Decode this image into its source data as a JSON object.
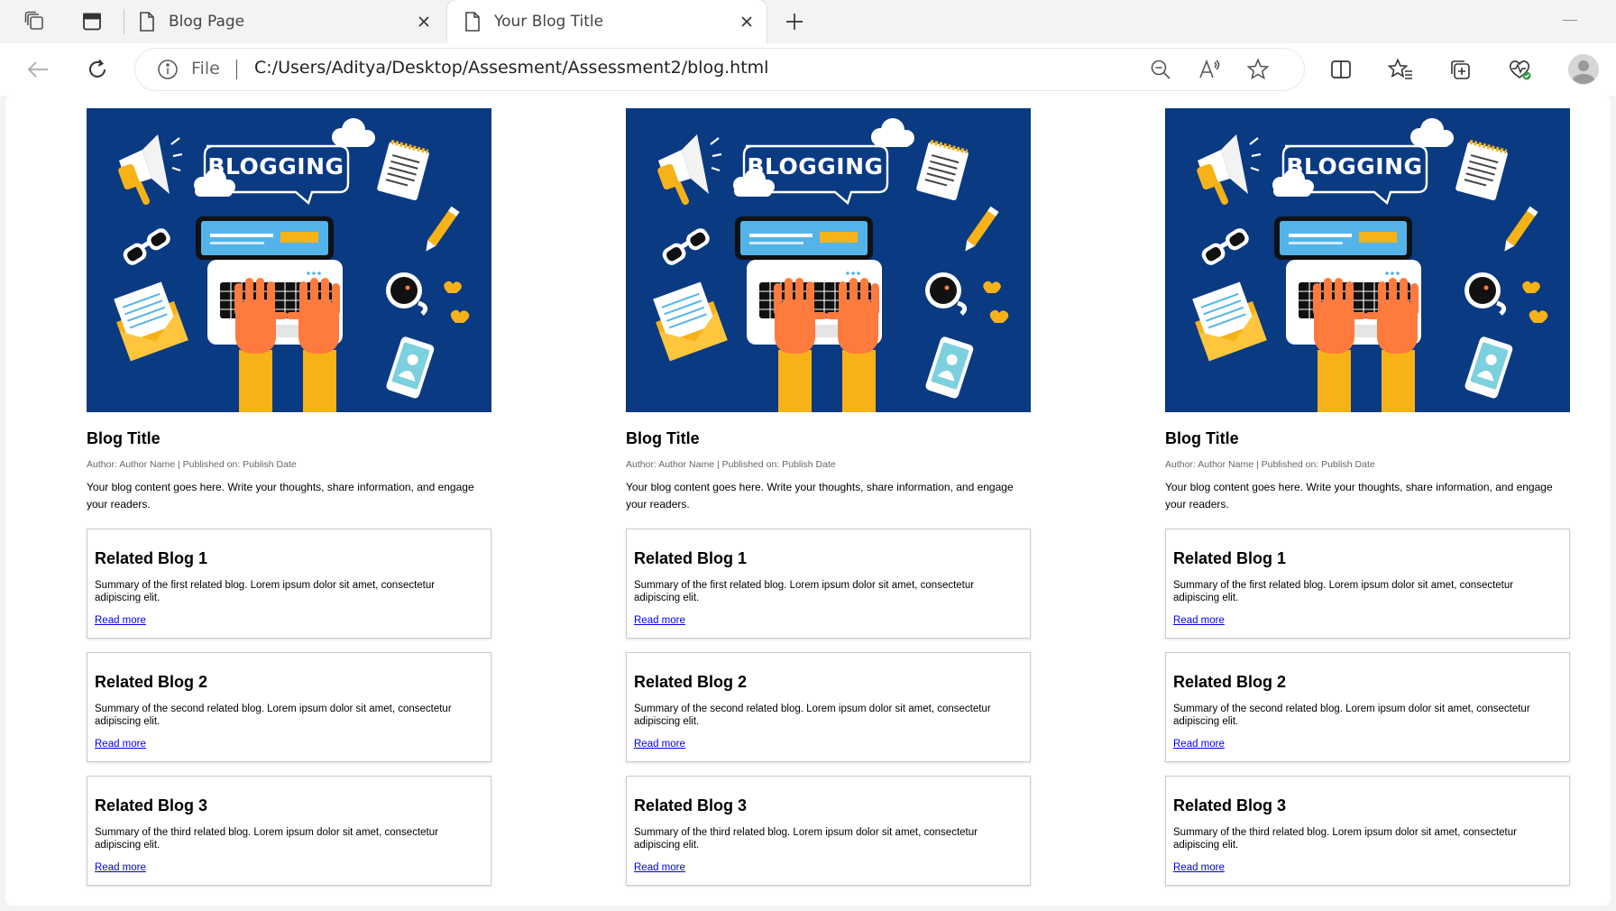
{
  "browser": {
    "tabs": [
      {
        "title": "Blog Page",
        "active": false
      },
      {
        "title": "Your Blog Title",
        "active": true
      }
    ],
    "address": {
      "scheme_label": "File",
      "url": "C:/Users/Aditya/Desktop/Assesment/Assessment2/blog.html"
    },
    "icons": {
      "workspaces": "workspaces-icon",
      "tab_actions": "vertical-tabs-icon",
      "page": "page-icon",
      "close": "close-icon",
      "new_tab": "plus-icon",
      "back": "back-arrow-icon",
      "refresh": "refresh-icon",
      "info": "info-icon",
      "zoom": "zoom-out-icon",
      "read_aloud": "read-aloud-icon",
      "favorite": "star-icon",
      "split_screen": "split-screen-icon",
      "favorites": "favorites-icon",
      "collections": "collections-icon",
      "health": "browser-essentials-icon",
      "profile": "profile-icon"
    }
  },
  "page": {
    "hero_text": "BLOGGING",
    "columns": [
      {
        "title": "Blog Title",
        "meta": "Author: Author Name | Published on: Publish Date",
        "content": "Your blog content goes here. Write your thoughts, share information, and engage your readers.",
        "related": [
          {
            "title": "Related Blog 1",
            "summary": "Summary of the first related blog. Lorem ipsum dolor sit amet, consectetur adipiscing elit.",
            "link": "Read more"
          },
          {
            "title": "Related Blog 2",
            "summary": "Summary of the second related blog. Lorem ipsum dolor sit amet, consectetur adipiscing elit.",
            "link": "Read more"
          },
          {
            "title": "Related Blog 3",
            "summary": "Summary of the third related blog. Lorem ipsum dolor sit amet, consectetur adipiscing elit.",
            "link": "Read more"
          }
        ]
      },
      {
        "title": "Blog Title",
        "meta": "Author: Author Name | Published on: Publish Date",
        "content": "Your blog content goes here. Write your thoughts, share information, and engage your readers.",
        "related": [
          {
            "title": "Related Blog 1",
            "summary": "Summary of the first related blog. Lorem ipsum dolor sit amet, consectetur adipiscing elit.",
            "link": "Read more"
          },
          {
            "title": "Related Blog 2",
            "summary": "Summary of the second related blog. Lorem ipsum dolor sit amet, consectetur adipiscing elit.",
            "link": "Read more"
          },
          {
            "title": "Related Blog 3",
            "summary": "Summary of the third related blog. Lorem ipsum dolor sit amet, consectetur adipiscing elit.",
            "link": "Read more"
          }
        ]
      },
      {
        "title": "Blog Title",
        "meta": "Author: Author Name | Published on: Publish Date",
        "content": "Your blog content goes here. Write your thoughts, share information, and engage your readers.",
        "related": [
          {
            "title": "Related Blog 1",
            "summary": "Summary of the first related blog. Lorem ipsum dolor sit amet, consectetur adipiscing elit.",
            "link": "Read more"
          },
          {
            "title": "Related Blog 2",
            "summary": "Summary of the second related blog. Lorem ipsum dolor sit amet, consectetur adipiscing elit.",
            "link": "Read more"
          },
          {
            "title": "Related Blog 3",
            "summary": "Summary of the third related blog. Lorem ipsum dolor sit amet, consectetur adipiscing elit.",
            "link": "Read more"
          }
        ]
      }
    ]
  },
  "colors": {
    "hero_background": "#0a3a82",
    "link": "#0000ee",
    "accent_yellow": "#f7b217"
  }
}
